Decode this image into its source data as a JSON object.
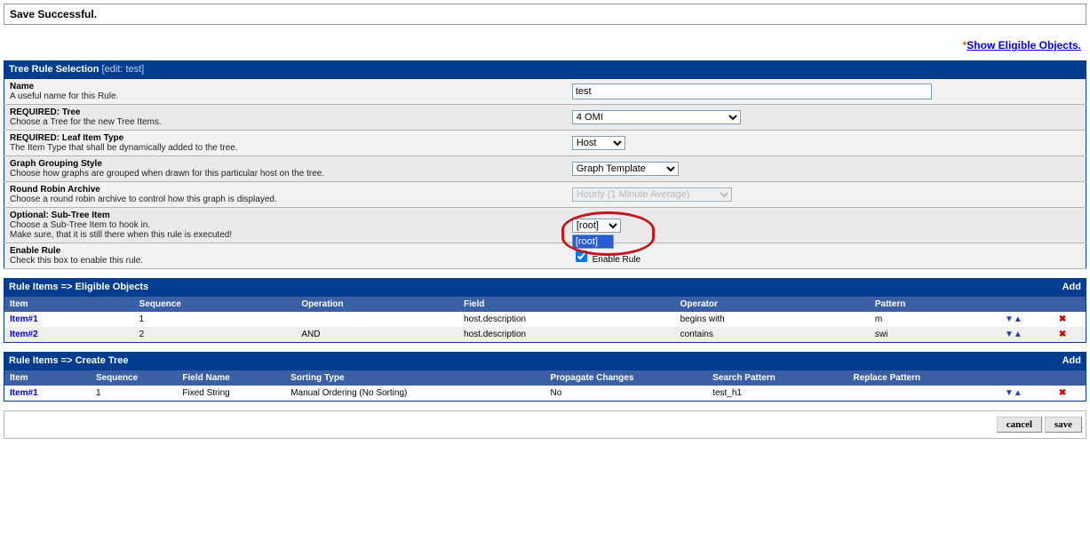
{
  "message": "Save Successful.",
  "top_link_text": "Show Eligible Objects.",
  "selection": {
    "header": "Tree Rule Selection",
    "edit_text": "[edit: test]",
    "rows": {
      "name": {
        "label": "Name",
        "desc": "A useful name for this Rule.",
        "value": "test"
      },
      "tree": {
        "label": "REQUIRED: Tree",
        "desc": "Choose a Tree for the new Tree Items.",
        "value": "4 OMI"
      },
      "leaf": {
        "label": "REQUIRED: Leaf Item Type",
        "desc": "The Item Type that shall be dynamically added to the tree.",
        "value": "Host"
      },
      "group": {
        "label": "Graph Grouping Style",
        "desc": "Choose how graphs are grouped when drawn for this particular host on the tree.",
        "value": "Graph Template"
      },
      "rra": {
        "label": "Round Robin Archive",
        "desc": "Choose a round robin archive to control how this graph is displayed.",
        "value": "Hourly (1 Minute Average)"
      },
      "subtree": {
        "label": "Optional: Sub-Tree Item",
        "desc": "Choose a Sub-Tree Item to hook in.",
        "desc2": "Make sure, that it is still there when this rule is executed!",
        "value": "[root]",
        "option": "[root]"
      },
      "enable": {
        "label": "Enable Rule",
        "desc": "Check this box to enable this rule.",
        "cblabel": "Enable Rule"
      }
    }
  },
  "eligible": {
    "header": "Rule Items => Eligible Objects",
    "add": "Add",
    "cols": {
      "item": "Item",
      "seq": "Sequence",
      "op": "Operation",
      "field": "Field",
      "oper": "Operator",
      "pat": "Pattern"
    },
    "rows": [
      {
        "item": "Item#1",
        "seq": "1",
        "op": "",
        "field": "host.description",
        "oper": "begins with",
        "pat": "m"
      },
      {
        "item": "Item#2",
        "seq": "2",
        "op": "AND",
        "field": "host.description",
        "oper": "contains",
        "pat": "swi"
      }
    ]
  },
  "createtree": {
    "header": "Rule Items => Create Tree",
    "add": "Add",
    "cols": {
      "item": "Item",
      "seq": "Sequence",
      "fname": "Field Name",
      "stype": "Sorting Type",
      "prop": "Propagate Changes",
      "sp": "Search Pattern",
      "rp": "Replace Pattern"
    },
    "rows": [
      {
        "item": "Item#1",
        "seq": "1",
        "fname": "Fixed String",
        "stype": "Manual Ordering (No Sorting)",
        "prop": "No",
        "sp": "test_h1",
        "rp": ""
      }
    ]
  },
  "buttons": {
    "cancel": "cancel",
    "save": "save"
  }
}
